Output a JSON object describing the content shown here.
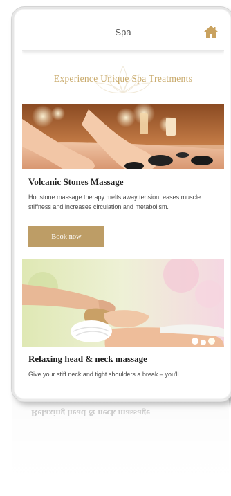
{
  "appbar": {
    "title": "Spa",
    "home_icon": "home-icon"
  },
  "headline": "Experience Unique Spa Treatments",
  "treatments": [
    {
      "title": "Volcanic Stones Massage",
      "description": "Hot stone massage therapy melts away tension, eases muscle stiffness and increases circulation and metabolism.",
      "button": "Book now",
      "image": "hot-stone-massage-photo"
    },
    {
      "title": "Relaxing head & neck massage",
      "description": "Give your stiff neck and tight shoulders a break – you'll",
      "image": "head-neck-massage-photo"
    }
  ],
  "colors": {
    "accent": "#bd9d66",
    "headline": "#c9aa6b",
    "title_text": "#1f1f1f"
  }
}
